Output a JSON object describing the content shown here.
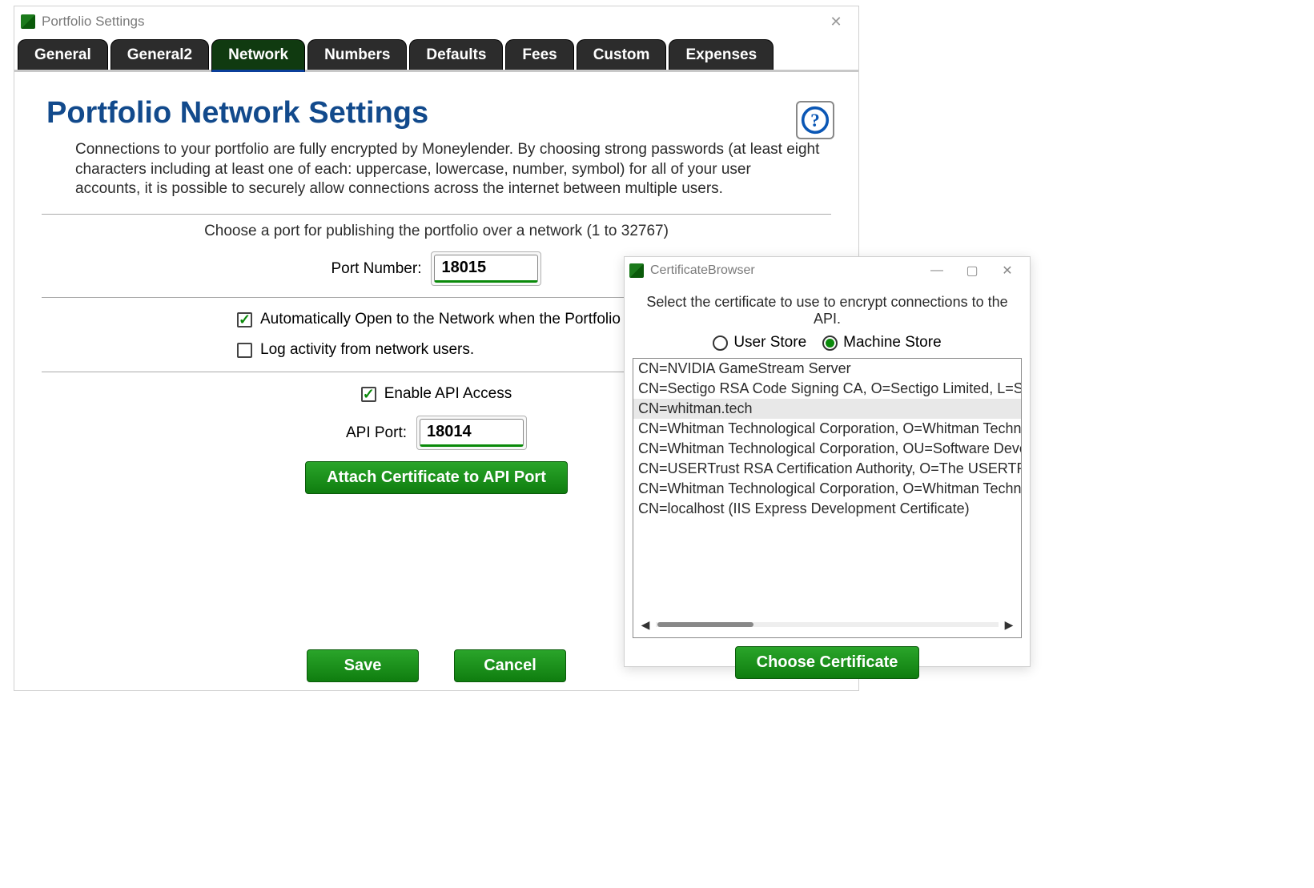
{
  "main": {
    "title": "Portfolio Settings",
    "tabs": [
      "General",
      "General2",
      "Network",
      "Numbers",
      "Defaults",
      "Fees",
      "Custom",
      "Expenses"
    ],
    "active_tab_index": 2,
    "heading": "Portfolio Network Settings",
    "description": "Connections to your portfolio are fully encrypted by Moneylender. By choosing strong passwords (at least eight characters including at least one of each: uppercase, lowercase, number, symbol) for all of your user accounts, it is possible to securely allow connections across the internet between multiple users.",
    "port_section": {
      "instruction": "Choose a port for publishing the portfolio over a network (1 to 32767)",
      "label": "Port Number:",
      "value": "18015"
    },
    "checks": {
      "auto_open": {
        "label": "Automatically Open to the Network when the Portfolio Opens.",
        "checked": true
      },
      "log_activity": {
        "label": "Log activity from network users.",
        "checked": false
      }
    },
    "api": {
      "enable_label": "Enable API Access",
      "enable_checked": true,
      "port_label": "API Port:",
      "port_value": "18014",
      "attach_button": "Attach Certificate to API Port"
    },
    "buttons": {
      "save": "Save",
      "cancel": "Cancel"
    }
  },
  "cert": {
    "title": "CertificateBrowser",
    "instruction": "Select the certificate to use to encrypt connections to the API.",
    "radios": {
      "user": "User Store",
      "machine": "Machine Store",
      "selected": "machine"
    },
    "items": [
      "CN=NVIDIA GameStream Server",
      "CN=Sectigo RSA Code Signing CA, O=Sectigo Limited, L=Salford",
      "CN=whitman.tech",
      "CN=Whitman Technological Corporation, O=Whitman Technological",
      "CN=Whitman Technological Corporation, OU=Software Develop",
      "CN=USERTrust RSA Certification Authority, O=The USERTRUST N",
      "CN=Whitman Technological Corporation, O=Whitman Technological",
      "CN=localhost (IIS Express Development Certificate)"
    ],
    "selected_index": 2,
    "choose_button": "Choose Certificate"
  }
}
